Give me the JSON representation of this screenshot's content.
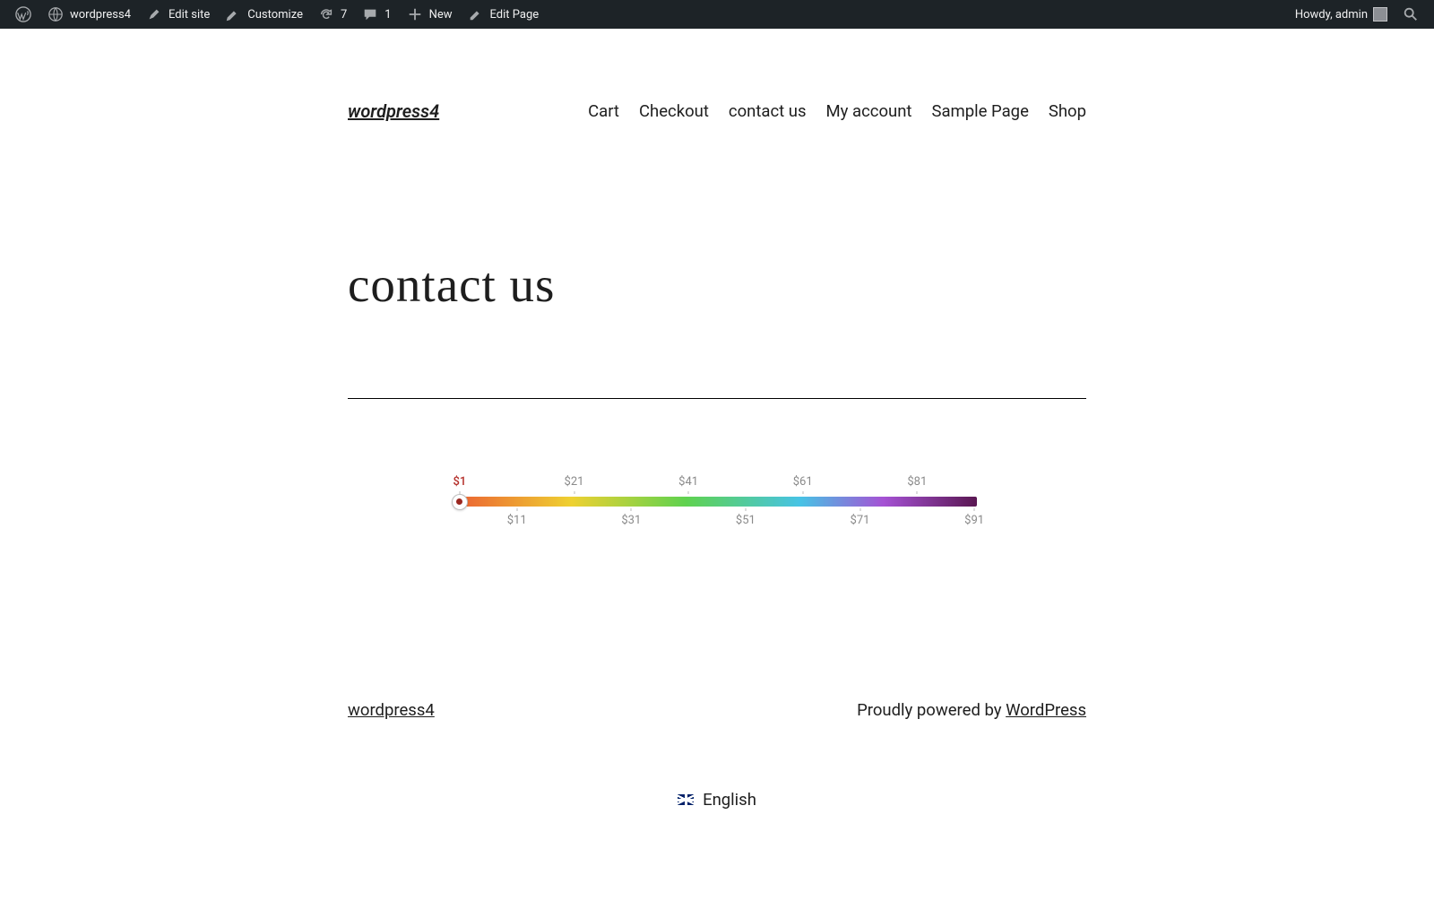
{
  "admin_bar": {
    "site_name": "wordpress4",
    "edit_site": "Edit site",
    "customize": "Customize",
    "updates_count": "7",
    "comments_count": "1",
    "new_label": "New",
    "edit_page": "Edit Page",
    "greeting": "Howdy, admin"
  },
  "header": {
    "site_title": "wordpress4",
    "nav": [
      "Cart",
      "Checkout",
      "contact us",
      "My account",
      "Sample Page",
      "Shop"
    ]
  },
  "page_title": "contact us",
  "slider": {
    "top_labels": [
      "$1",
      "$21",
      "$41",
      "$61",
      "$81"
    ],
    "top_positions": [
      0.5,
      22.5,
      44.5,
      66.5,
      88.5
    ],
    "bottom_labels": [
      "$11",
      "$31",
      "$51",
      "$71",
      "$91"
    ],
    "bottom_positions": [
      11.5,
      33.5,
      55.5,
      77.5,
      99.5
    ],
    "active_index": 0,
    "handle_position": 0.5
  },
  "footer": {
    "site_link": "wordpress4",
    "credit_prefix": "Proudly powered by ",
    "credit_link": "WordPress"
  },
  "language": {
    "label": "English"
  }
}
